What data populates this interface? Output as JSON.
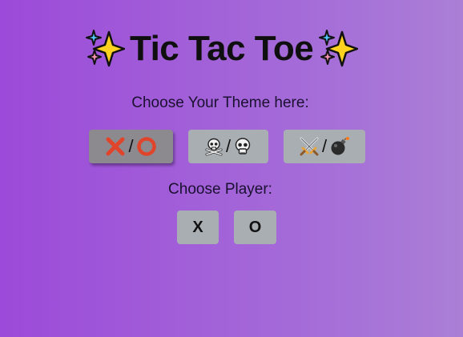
{
  "header": {
    "title": "Tic Tac Toe",
    "left_icon": "sparkles-icon",
    "right_icon": "sparkles-icon"
  },
  "themes": {
    "label": "Choose Your Theme here:",
    "separator": "/",
    "options": [
      {
        "icons": [
          "cross-mark-icon",
          "hollow-circle-icon"
        ],
        "selected": true
      },
      {
        "icons": [
          "skull-crossbones-icon",
          "skull-icon"
        ],
        "selected": false
      },
      {
        "icons": [
          "crossed-swords-icon",
          "bomb-icon"
        ],
        "selected": false
      }
    ]
  },
  "players": {
    "label": "Choose Player:",
    "options": [
      "X",
      "O"
    ]
  },
  "colors": {
    "background_start": "#9c4ad9",
    "background_end": "#ab7fd6",
    "button": "#a9aeb2",
    "button_selected": "#8c8a8f",
    "sparkle_yellow": "#ffd21f",
    "cross_red": "#e0442b"
  }
}
